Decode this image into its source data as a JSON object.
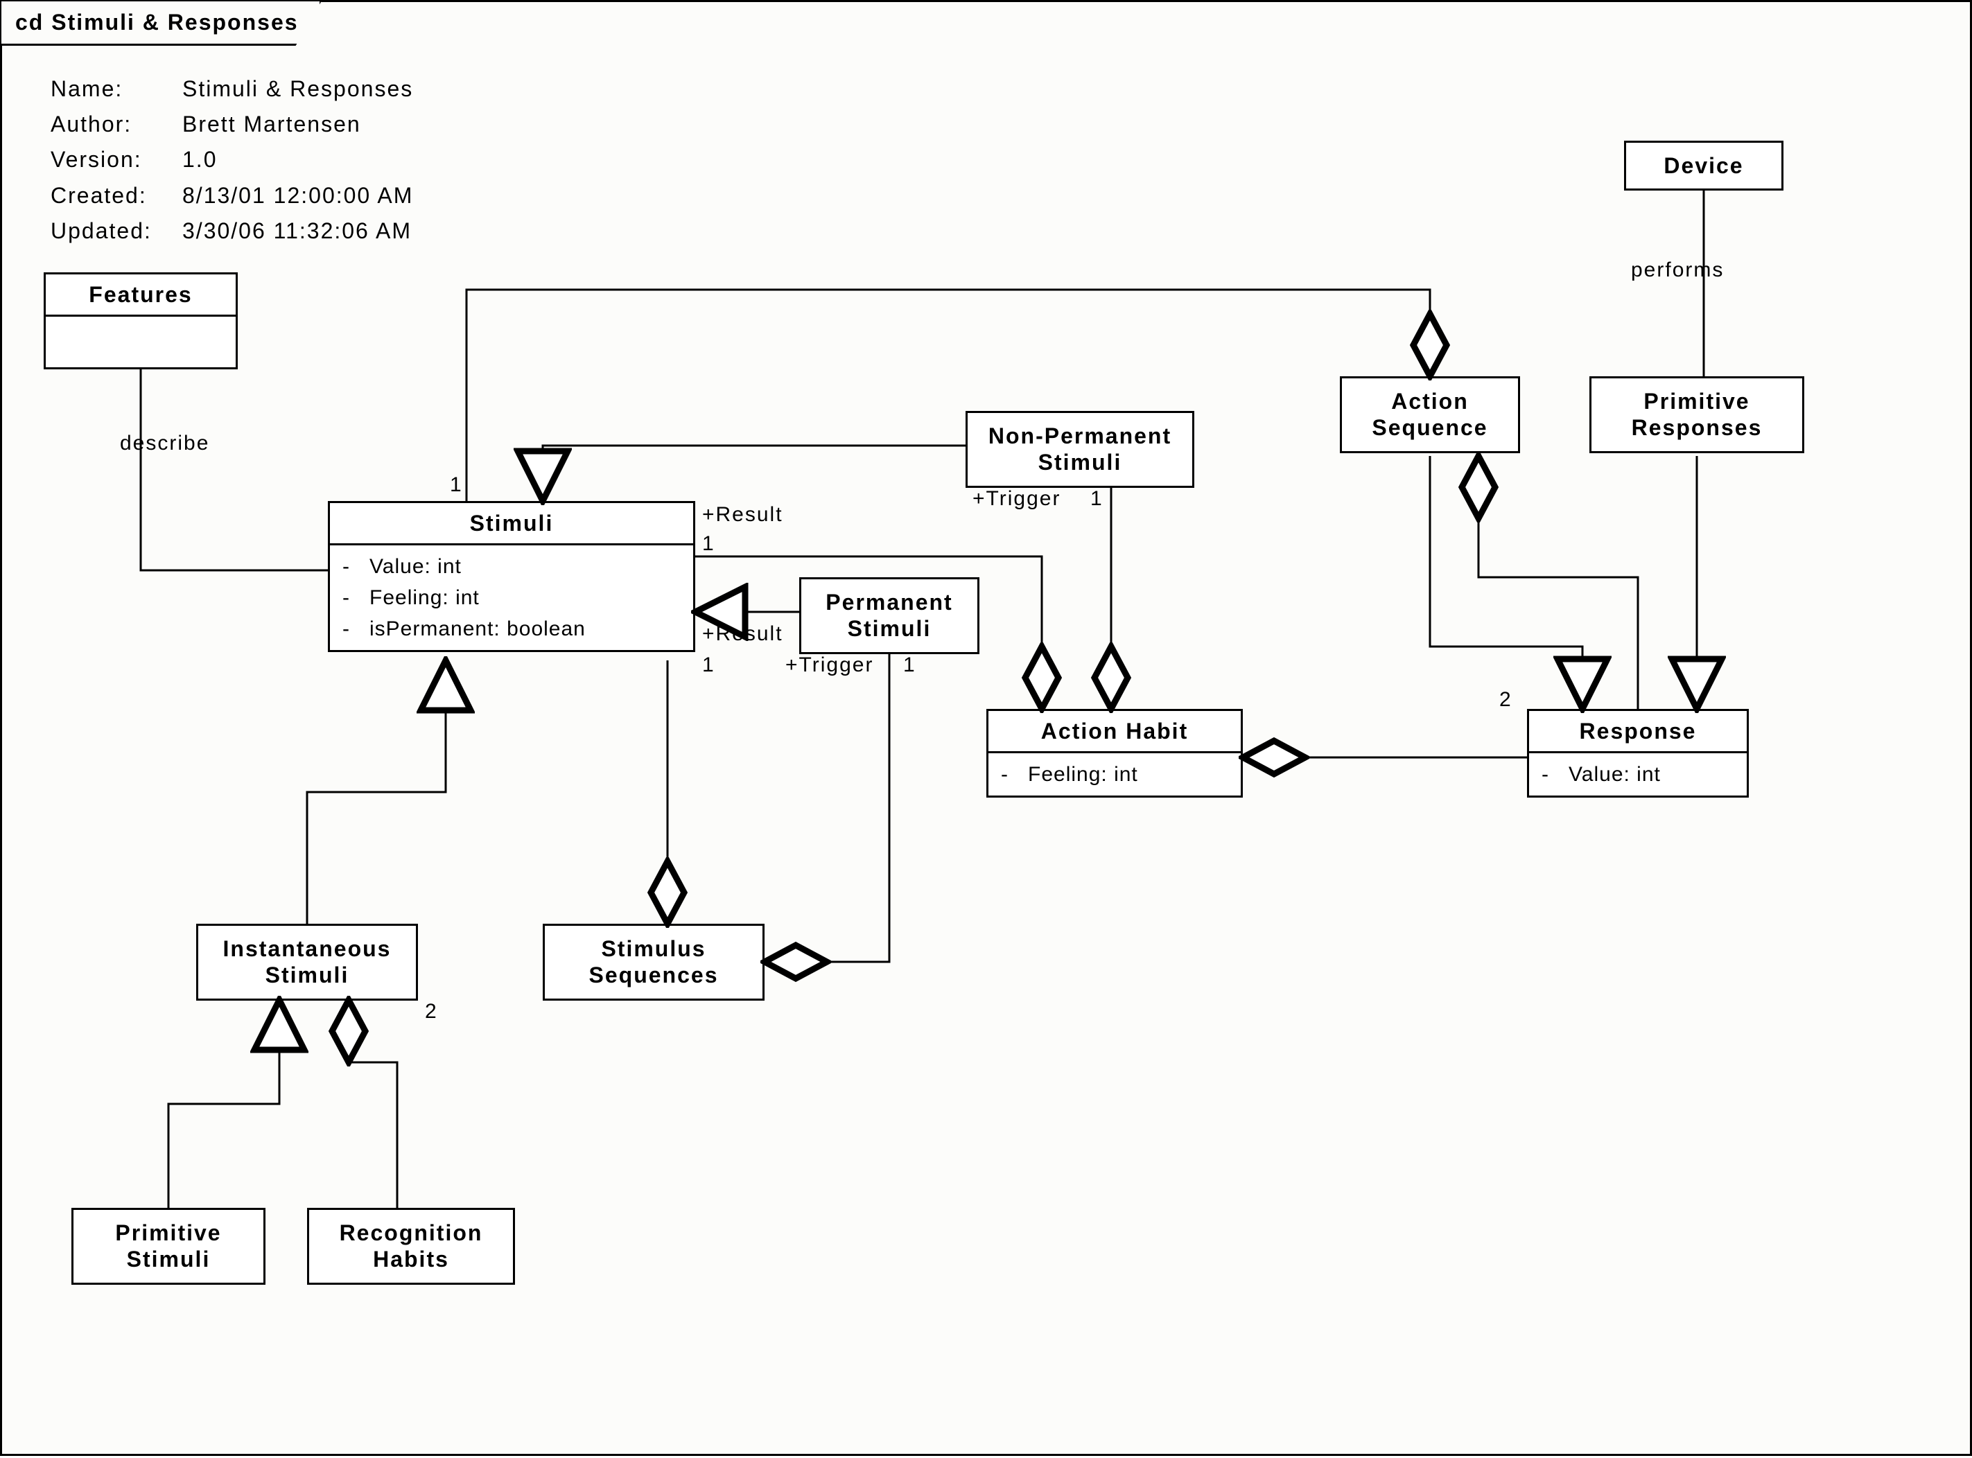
{
  "header": {
    "tab": "cd Stimuli & Responses"
  },
  "meta": {
    "name_lbl": "Name:",
    "name_val": "Stimuli & Responses",
    "author_lbl": "Author:",
    "author_val": "Brett Martensen",
    "version_lbl": "Version:",
    "version_val": "1.0",
    "created_lbl": "Created:",
    "created_val": "8/13/01 12:00:00 AM",
    "updated_lbl": "Updated:",
    "updated_val": "3/30/06 11:32:06 AM"
  },
  "classes": {
    "features": {
      "name": "Features"
    },
    "stimuli": {
      "name": "Stimuli",
      "attrs": [
        "Value: int",
        "Feeling: int",
        "isPermanent: boolean"
      ]
    },
    "nonperm": {
      "name": "Non-Permanent Stimuli"
    },
    "perm": {
      "name": "Permanent Stimuli"
    },
    "device": {
      "name": "Device"
    },
    "actseq": {
      "name": "Action Sequence"
    },
    "primresp": {
      "name": "Primitive Responses"
    },
    "acthabit": {
      "name": "Action Habit",
      "attrs": [
        "Feeling: int"
      ]
    },
    "response": {
      "name": "Response",
      "attrs": [
        "Value: int"
      ]
    },
    "instant": {
      "name": "Instantaneous Stimuli"
    },
    "stimseq": {
      "name": "Stimulus Sequences"
    },
    "primstim": {
      "name": "Primitive Stimuli"
    },
    "rechabits": {
      "name": "Recognition Habits"
    }
  },
  "labels": {
    "describe": "describe",
    "performs": "performs",
    "result1": "+Result",
    "result2": "+Result",
    "trigger1": "+Trigger",
    "trigger2": "+Trigger",
    "m1a": "1",
    "m1b": "1",
    "m1c": "1",
    "m1d": "1",
    "m1e": "1",
    "m2a": "2",
    "m2b": "2"
  }
}
